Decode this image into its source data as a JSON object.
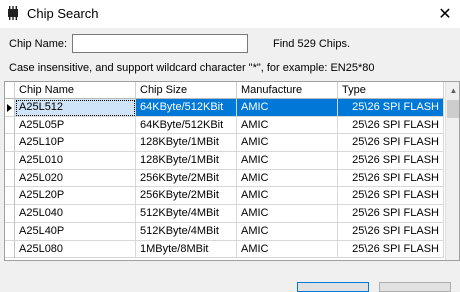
{
  "window": {
    "title": "Chip Search",
    "close_glyph": "✕"
  },
  "search": {
    "label": "Chip Name:",
    "value": "",
    "result_text": "Find 529 Chips.",
    "hint": "Case insensitive, and support wildcard character \"*\", for example: EN25*80"
  },
  "table": {
    "columns": [
      "Chip Name",
      "Chip Size",
      "Manufacture",
      "Type"
    ],
    "rows": [
      [
        "A25L512",
        "64KByte/512KBit",
        "AMIC",
        "25\\26 SPI FLASH"
      ],
      [
        "A25L05P",
        "64KByte/512KBit",
        "AMIC",
        "25\\26 SPI FLASH"
      ],
      [
        "A25L10P",
        "128KByte/1MBit",
        "AMIC",
        "25\\26 SPI FLASH"
      ],
      [
        "A25L010",
        "128KByte/1MBit",
        "AMIC",
        "25\\26 SPI FLASH"
      ],
      [
        "A25L020",
        "256KByte/2MBit",
        "AMIC",
        "25\\26 SPI FLASH"
      ],
      [
        "A25L20P",
        "256KByte/2MBit",
        "AMIC",
        "25\\26 SPI FLASH"
      ],
      [
        "A25L040",
        "512KByte/4MBit",
        "AMIC",
        "25\\26 SPI FLASH"
      ],
      [
        "A25L40P",
        "512KByte/4MBit",
        "AMIC",
        "25\\26 SPI FLASH"
      ],
      [
        "A25L080",
        "1MByte/8MBit",
        "AMIC",
        "25\\26 SPI FLASH"
      ]
    ],
    "selected_row": 0
  },
  "colors": {
    "selection": "#0078d7",
    "window_bg": "#f0f0f0"
  },
  "icons": {
    "app": "chip-icon",
    "close": "close-icon"
  }
}
